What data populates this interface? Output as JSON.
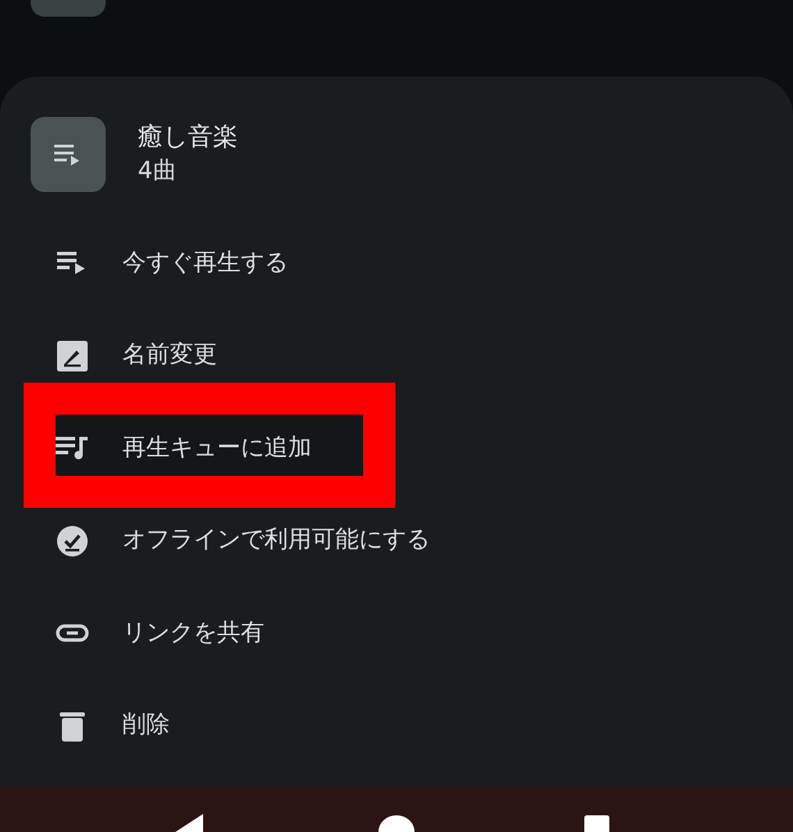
{
  "playlist": {
    "title": "癒し音楽",
    "subtitle": "4曲"
  },
  "menu": [
    {
      "kind": "play",
      "label": "今すぐ再生する",
      "highlighted": false
    },
    {
      "kind": "rename",
      "label": "名前変更",
      "highlighted": false
    },
    {
      "kind": "queue",
      "label": "再生キューに追加",
      "highlighted": true
    },
    {
      "kind": "offline",
      "label": "オフラインで利用可能にする",
      "highlighted": false
    },
    {
      "kind": "link",
      "label": "リンクを共有",
      "highlighted": false
    },
    {
      "kind": "delete",
      "label": "削除",
      "highlighted": false
    }
  ]
}
